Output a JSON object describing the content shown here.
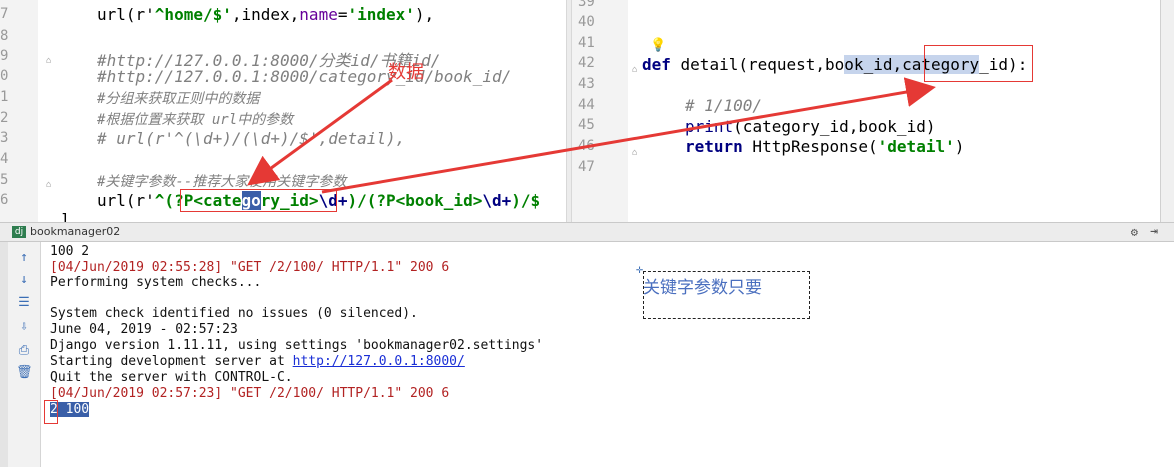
{
  "left_editor": {
    "line_numbers": [
      "7",
      "8",
      "9",
      "0",
      "1",
      "2",
      "3",
      "4",
      "5",
      "6"
    ],
    "lines": {
      "l1_a": "url(r'",
      "l1_b": "^home/$'",
      "l1_c": ",index,",
      "l1_d": "name",
      "l1_e": "=",
      "l1_f": "'index'",
      "l1_g": "),",
      "l3": "#http://127.0.0.1:8000/分类id/书籍id/",
      "l4": "#http://127.0.0.1:8000/category_id/book_id/",
      "l5": "#分组来获取正则中的数据",
      "l6": "#根据位置来获取 url中的参数",
      "l7": "# url(r'^(\\d+)/(\\d+)/$',detail),",
      "l9": "#关键字参数--推荐大家使用关键字参数",
      "l10_a": "url(r'",
      "l10_b": "^(?P<cate",
      "l10_c": "go",
      "l10_d": "ry_id>",
      "l10_e": "\\d+",
      "l10_f": ")/(?P<book_id>",
      "l10_g": "\\d+",
      "l10_h": ")/$"
    },
    "bottom_brace": "]"
  },
  "right_editor": {
    "line_numbers": [
      "39",
      "40",
      "41",
      "42",
      "43",
      "44",
      "45",
      "46",
      "47"
    ],
    "lines": {
      "def_kw": "def",
      "def_name": " detail(request,bo",
      "def_sel": "ok_id,category",
      "def_rest": "_id):",
      "comment": "# 1/100/",
      "print_a": "print",
      "print_b": "(category_id,book_id)",
      "return_kw": "return",
      "return_a": " HttpResponse(",
      "return_str": "'detail'",
      "return_b": ")"
    }
  },
  "run_panel": {
    "title": "bookmanager02",
    "tab_icon": "dj",
    "console": [
      {
        "text": "100 2",
        "style": "normal"
      },
      {
        "text": "[04/Jun/2019 02:55:28] \"GET /2/100/ HTTP/1.1\" 200 6",
        "style": "red"
      },
      {
        "text": "Performing system checks...",
        "style": "normal"
      },
      {
        "text": "",
        "style": "normal"
      },
      {
        "text": "System check identified no issues (0 silenced).",
        "style": "normal"
      },
      {
        "text": "June 04, 2019 - 02:57:23",
        "style": "normal"
      },
      {
        "text": "Django version 1.11.11, using settings 'bookmanager02.settings'",
        "style": "normal"
      },
      {
        "text": "Starting development server at ",
        "style": "normal"
      },
      {
        "text": "Quit the server with CONTROL-C.",
        "style": "normal"
      },
      {
        "text": "[04/Jun/2019 02:57:23] \"GET /2/100/ HTTP/1.1\" 200 6",
        "style": "red"
      },
      {
        "text": "2 100",
        "style": "selected"
      }
    ],
    "server_link": "http://127.0.0.1:8000/"
  },
  "annotations": {
    "data_label": "数据",
    "note_text": "关键字参数只要",
    "arrow_color": "#e53935"
  },
  "colors": {
    "keyword": "#000080",
    "string": "#008000",
    "comment": "#808080",
    "selection": "#3a5fa8",
    "console_red": "#b22222",
    "link": "#1a2fd6"
  }
}
